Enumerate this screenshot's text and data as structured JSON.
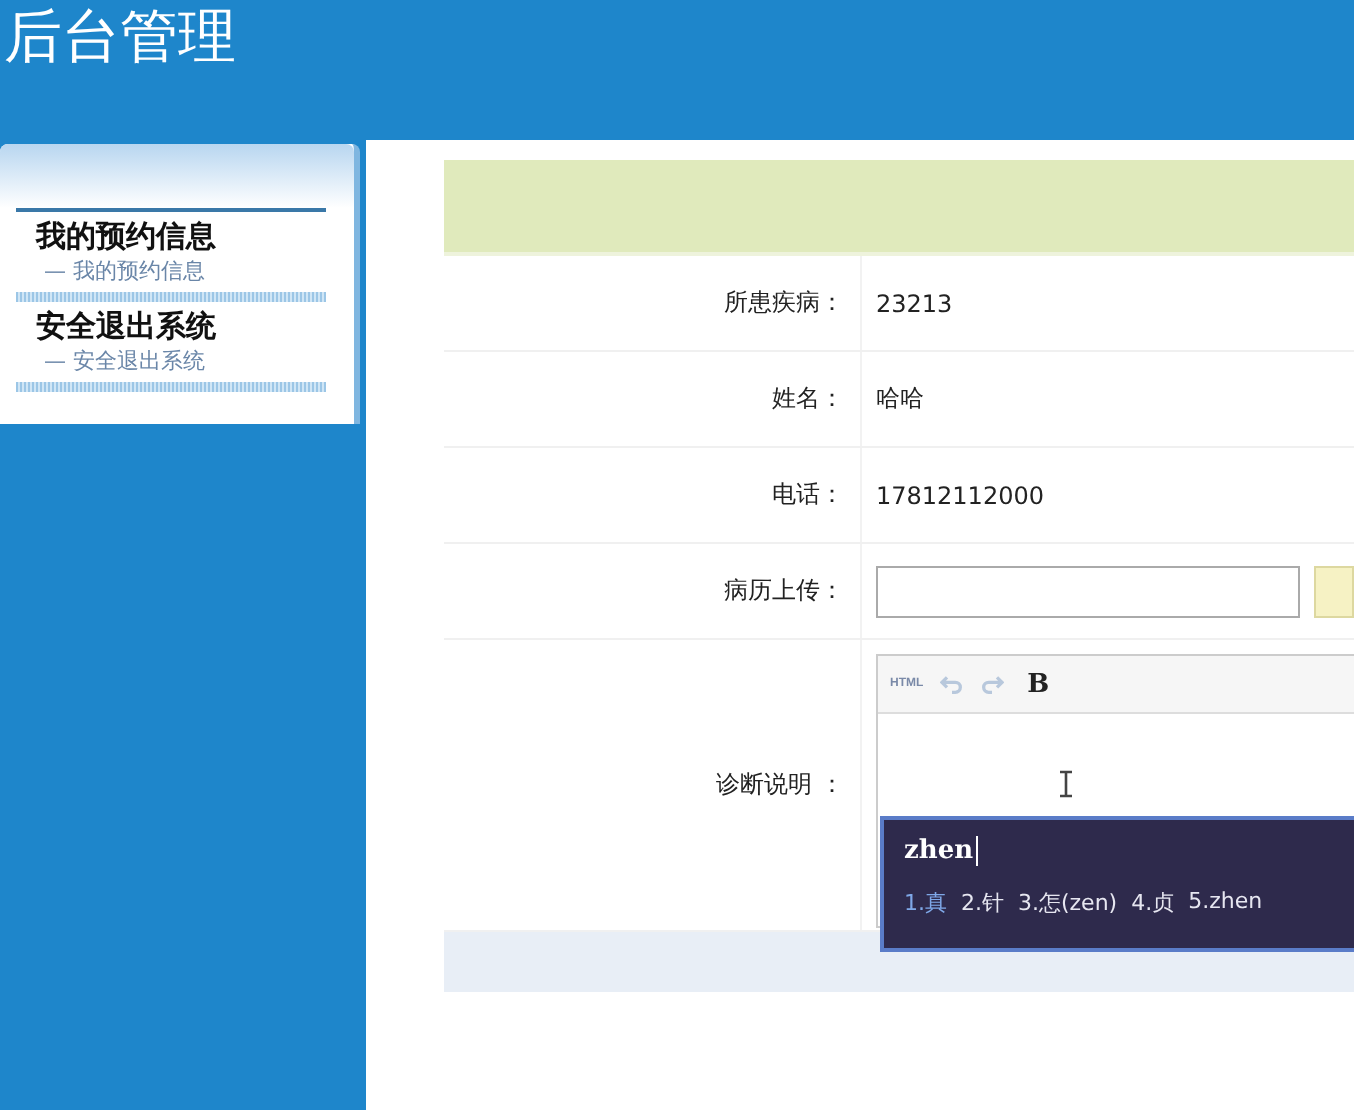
{
  "header": {
    "title": "后台管理"
  },
  "sidebar": {
    "groups": [
      {
        "title": "我的预约信息",
        "items": [
          {
            "label": "— 我的预约信息"
          }
        ]
      },
      {
        "title": "安全退出系统",
        "items": [
          {
            "label": "— 安全退出系统"
          }
        ]
      }
    ]
  },
  "form": {
    "rows": [
      {
        "kind": "text",
        "label": "所患疾病：",
        "value": "23213"
      },
      {
        "kind": "text",
        "label": "姓名：",
        "value": "哈哈"
      },
      {
        "kind": "text",
        "label": "电话：",
        "value": "17812112000"
      },
      {
        "kind": "upload",
        "label": "病历上传："
      },
      {
        "kind": "editor",
        "label": "诊断说明 ："
      }
    ],
    "toolbar": [
      {
        "kind": "html",
        "label": "HTML"
      },
      {
        "kind": "undo"
      },
      {
        "kind": "redo"
      },
      {
        "kind": "bold",
        "label": "B"
      }
    ]
  },
  "ime": {
    "composition": "zhen",
    "candidates": [
      {
        "label": "1.真",
        "selected": true
      },
      {
        "label": "2.针",
        "selected": false
      },
      {
        "label": "3.怎(zen)",
        "selected": false
      },
      {
        "label": "4.贞",
        "selected": false
      },
      {
        "label": "5.zhen",
        "selected": false
      }
    ]
  }
}
